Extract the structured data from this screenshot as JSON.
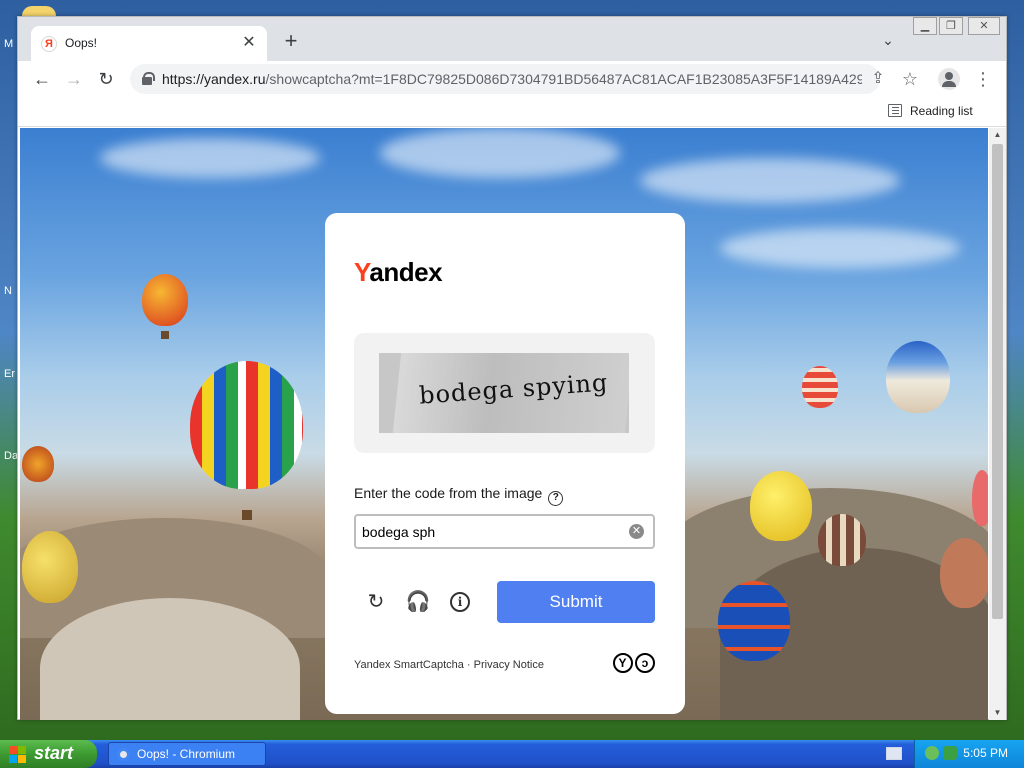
{
  "desktop": {
    "labels": [
      "M",
      "N",
      "Er",
      "Da"
    ]
  },
  "browser": {
    "tab_title": "Oops!",
    "tab_favicon": "Я",
    "url_host": "https://yandex.ru",
    "url_path": "/showcaptcha?mt=1F8DC79825D086D7304791BD56487AC81ACAF1B23085A3F5F14189A429...",
    "reading_list": "Reading list"
  },
  "captcha": {
    "logo_first": "Y",
    "logo_rest": "andex",
    "image_text": "bodega spying",
    "prompt": "Enter the code from the image",
    "input_value": "bodega sph",
    "submit_label": "Submit",
    "footer_brand": "Yandex SmartCaptcha",
    "footer_sep": " · ",
    "footer_privacy": "Privacy Notice",
    "colors": {
      "brand_red": "#fc3f1d",
      "submit_blue": "#4f7ff0"
    }
  },
  "taskbar": {
    "start_label": "start",
    "task_label": "Oops! - Chromium",
    "clock": "5:05 PM"
  }
}
